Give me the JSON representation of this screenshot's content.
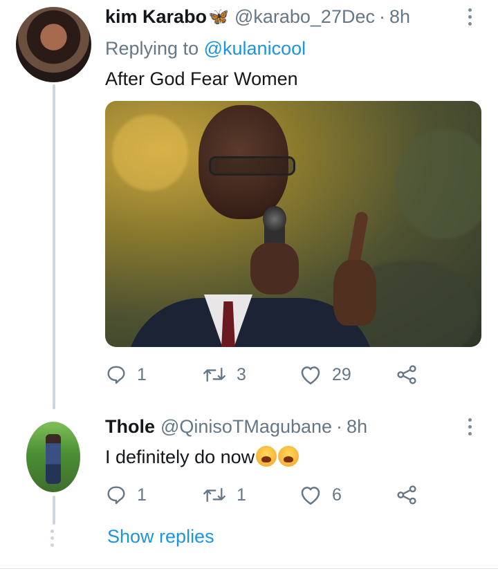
{
  "tweet1": {
    "name": "kim Karabo",
    "name_emoji": "🦋",
    "handle": "@karabo_27Dec",
    "separator": "·",
    "time": "8h",
    "replying_prefix": "Replying to",
    "replying_mention": "@kulanicool",
    "text": "After God Fear Women",
    "actions": {
      "replies": "1",
      "retweets": "3",
      "likes": "29"
    }
  },
  "tweet2": {
    "name": "Thole",
    "handle": "@QinisoTMagubane",
    "separator": "·",
    "time": "8h",
    "text": "I definitely do now",
    "text_emojis": [
      "😫",
      "😫"
    ],
    "actions": {
      "replies": "1",
      "retweets": "1",
      "likes": "6"
    }
  },
  "show_replies_label": "Show replies",
  "colors": {
    "link": "#1b95e0",
    "secondary_text": "#657786",
    "thread_line": "#ccd6dd"
  },
  "icons": [
    "reply-icon",
    "retweet-icon",
    "like-icon",
    "share-icon",
    "more-options-icon"
  ]
}
